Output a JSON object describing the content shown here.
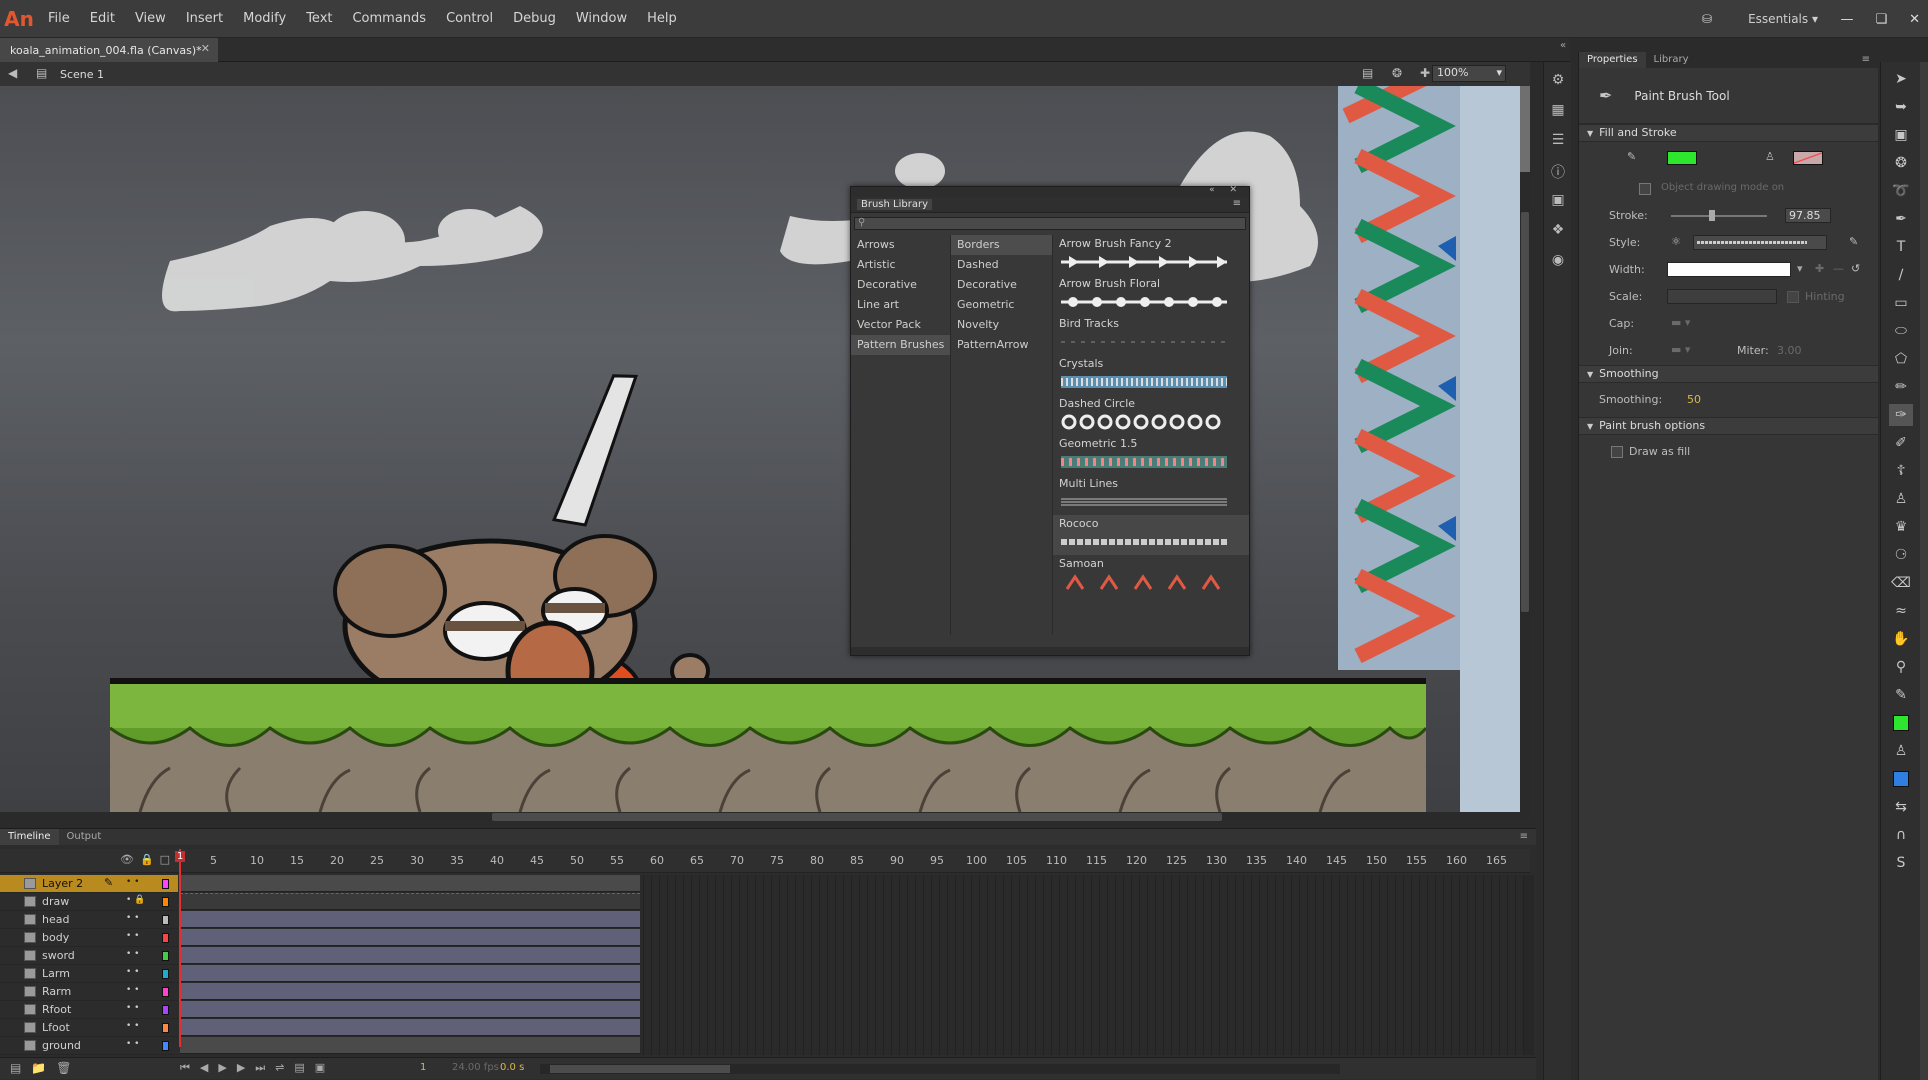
{
  "app": {
    "logo": "An"
  },
  "menu": [
    "File",
    "Edit",
    "View",
    "Insert",
    "Modify",
    "Text",
    "Commands",
    "Control",
    "Debug",
    "Window",
    "Help"
  ],
  "workspace": {
    "label": "Essentials",
    "icon": "sync-settings-icon"
  },
  "document": {
    "tab_title": "koala_animation_004.fla (Canvas)*",
    "scene": "Scene 1",
    "zoom": "100%"
  },
  "brush_library": {
    "title": "Brush Library",
    "categories": [
      "Arrows",
      "Artistic",
      "Decorative",
      "Line art",
      "Vector Pack",
      "Pattern Brushes"
    ],
    "selected_category": "Pattern Brushes",
    "subcategories": [
      "Borders",
      "Dashed",
      "Decorative",
      "Geometric",
      "Novelty",
      "PatternArrow"
    ],
    "selected_subcategory": "Borders",
    "brushes": [
      "Arrow Brush Fancy 2",
      "Arrow Brush Floral",
      "Bird Tracks",
      "Crystals",
      "Dashed Circle",
      "Geometric 1.5",
      "Multi Lines",
      "Rococo",
      "Samoan"
    ],
    "selected_brush": "Rococo"
  },
  "properties": {
    "tabs": [
      "Properties",
      "Library"
    ],
    "tool_name": "Paint Brush Tool",
    "sections": {
      "fill_stroke": "Fill and Stroke",
      "smoothing": "Smoothing",
      "brush_options": "Paint brush options"
    },
    "object_drawing": "Object drawing mode on",
    "stroke_label": "Stroke:",
    "stroke_value": "97.85",
    "style_label": "Style:",
    "width_label": "Width:",
    "scale_label": "Scale:",
    "hinting": "Hinting",
    "cap_label": "Cap:",
    "join_label": "Join:",
    "miter_label": "Miter:",
    "miter_value": "3.00",
    "smoothing_label": "Smoothing:",
    "smoothing_value": "50",
    "draw_as_fill": "Draw as fill",
    "stroke_color": "#2ee62e",
    "fill_color": "#c8a8a8"
  },
  "timeline": {
    "tabs": [
      "Timeline",
      "Output"
    ],
    "current_frame": "1",
    "frame_numbers": [
      "5",
      "10",
      "15",
      "20",
      "25",
      "30",
      "35",
      "40",
      "45",
      "50",
      "55",
      "60",
      "65",
      "70",
      "75",
      "80",
      "85",
      "90",
      "95",
      "100",
      "105",
      "110",
      "115",
      "120",
      "125",
      "130",
      "135",
      "140",
      "145",
      "150",
      "155",
      "160",
      "165"
    ],
    "layers": [
      {
        "name": "Layer 2",
        "color": "#ff44ff"
      },
      {
        "name": "draw",
        "color": "#ff8800"
      },
      {
        "name": "head",
        "color": "#bbbbbb"
      },
      {
        "name": "body",
        "color": "#ff4444"
      },
      {
        "name": "sword",
        "color": "#44cc44"
      },
      {
        "name": "Larm",
        "color": "#22aacc"
      },
      {
        "name": "Rarm",
        "color": "#ff44cc"
      },
      {
        "name": "Rfoot",
        "color": "#aa44ff"
      },
      {
        "name": "Lfoot",
        "color": "#ff8844"
      },
      {
        "name": "ground",
        "color": "#4488ff"
      }
    ],
    "fps_readout": "24.00 fps",
    "time_readout": "0.0 s"
  },
  "colors": {
    "accent_green": "#2ee62e",
    "layer_selected": "#b98a1e"
  }
}
